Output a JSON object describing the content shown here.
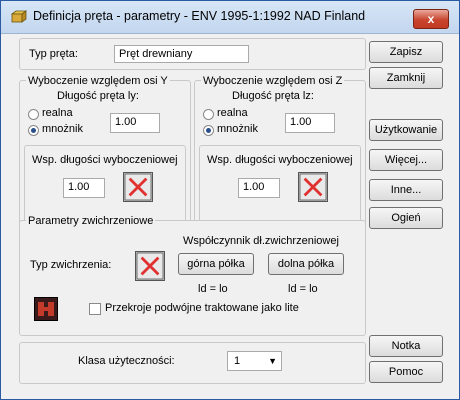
{
  "window": {
    "title": "Definicja pręta - parametry - ENV 1995-1:1992 NAD Finland",
    "close_glyph": "x"
  },
  "bar_type": {
    "label": "Typ pręta:",
    "value": "Pręt drewniany"
  },
  "buckling_y": {
    "title": "Wyboczenie względem osi Y",
    "length_label": "Długość pręta ly:",
    "option_real": "realna",
    "option_factor": "mnożnik",
    "selected": "mnożnik",
    "value": "1.00",
    "coef_label": "Wsp. długości wyboczeniowej",
    "coef_value": "1.00"
  },
  "buckling_z": {
    "title": "Wyboczenie względem osi Z",
    "length_label": "Długość pręta lz:",
    "option_real": "realna",
    "option_factor": "mnożnik",
    "selected": "mnożnik",
    "value": "1.00",
    "coef_label": "Wsp. długości wyboczeniowej",
    "coef_value": "1.00"
  },
  "lateral": {
    "title": "Parametry zwichrzeniowe",
    "factor_label": "Współczynnik dł.zwichrzeniowej",
    "type_label": "Typ zwichrzenia:",
    "top_flange": "górna półka",
    "bottom_flange": "dolna półka",
    "top_formula": "ld = lo",
    "bottom_formula": "ld = lo",
    "checkbox_label": "Przekroje podwójne traktowane jako lite",
    "checkbox_checked": false
  },
  "service_class": {
    "label": "Klasa użyteczności:",
    "value": "1"
  },
  "buttons": {
    "save": "Zapisz",
    "close": "Zamknij",
    "usage": "Użytkowanie",
    "more": "Więcej...",
    "other": "Inne...",
    "fire": "Ogień",
    "note": "Notka",
    "help": "Pomoc"
  },
  "colors": {
    "title_bg": "#c9daf0",
    "close_red": "#c8452f",
    "cross_red": "#e03030",
    "radio_dot": "#2b4f8a"
  }
}
